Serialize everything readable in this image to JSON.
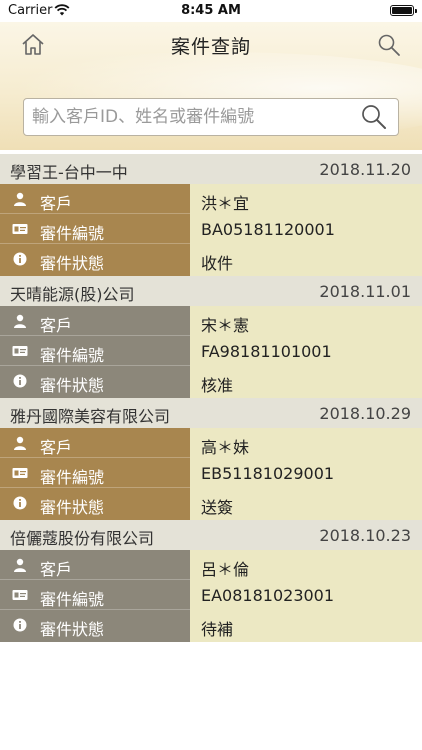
{
  "status_bar": {
    "carrier": "Carrier",
    "time": "8:45 AM"
  },
  "header": {
    "title": "案件查詢"
  },
  "search": {
    "placeholder": "輸入客戶ID、姓名或審件編號",
    "value": ""
  },
  "labels": {
    "customer": "客戶",
    "case_no": "審件編號",
    "case_status": "審件狀態"
  },
  "colors": {
    "label_brown": "#a8864f",
    "label_gray": "#8c877a",
    "value_bg": "#ece8c3",
    "header_row": "#e4e2d7"
  },
  "cases": [
    {
      "name": "學習王-台中一中",
      "date": "2018.11.20",
      "customer": "洪＊宜",
      "case_no": "BA05181120001",
      "status": "收件",
      "style": "brown"
    },
    {
      "name": "天晴能源(股)公司",
      "date": "2018.11.01",
      "customer": "宋＊憲",
      "case_no": "FA98181101001",
      "status": "核准",
      "style": "gray"
    },
    {
      "name": "雅丹國際美容有限公司",
      "date": "2018.10.29",
      "customer": "高＊妹",
      "case_no": "EB51181029001",
      "status": "送簽",
      "style": "brown"
    },
    {
      "name": "倍儷蔻股份有限公司",
      "date": "2018.10.23",
      "customer": "呂＊倫",
      "case_no": "EA08181023001",
      "status": "待補",
      "style": "gray"
    }
  ]
}
